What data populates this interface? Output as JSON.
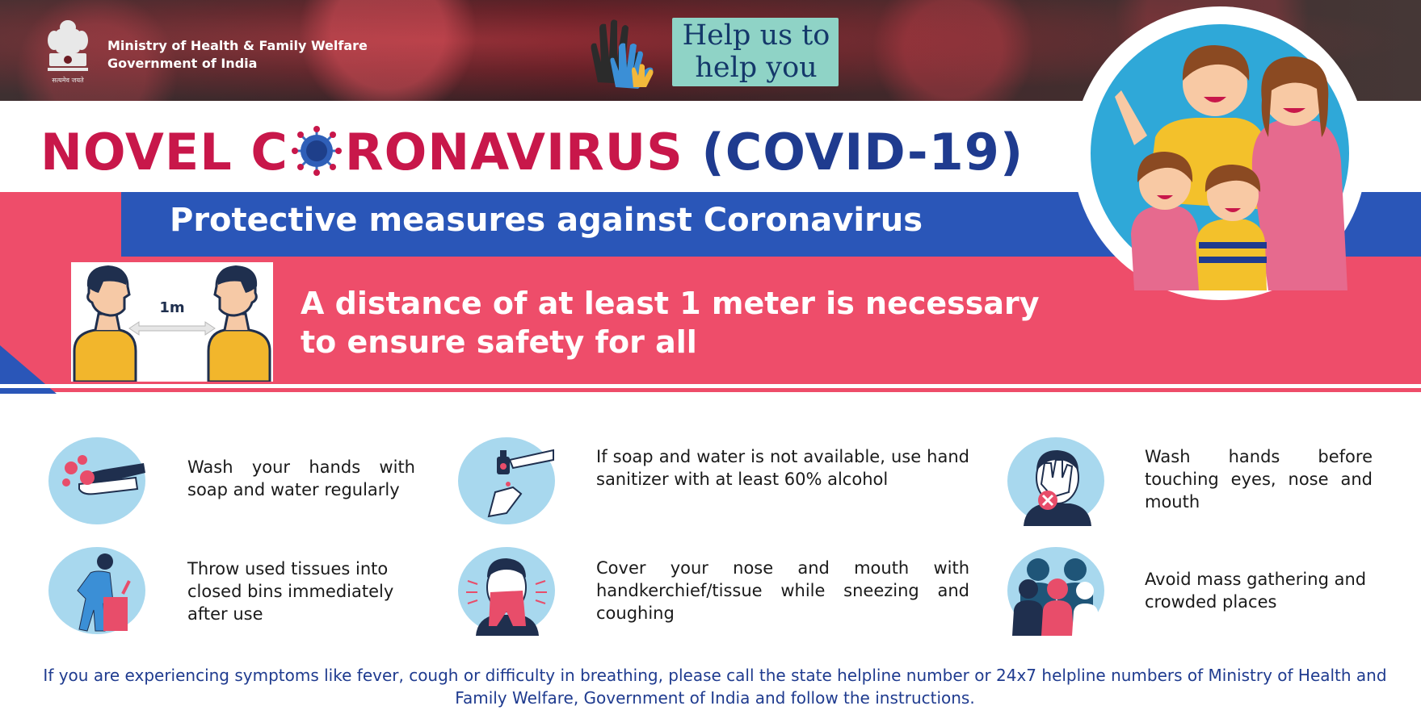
{
  "header": {
    "ministry_line1": "Ministry of Health & Family Welfare",
    "ministry_line2": "Government of India",
    "emblem_motto": "सत्यमेव जयते",
    "help_line1": "Help us to",
    "help_line2": "help you"
  },
  "title": {
    "part1": "NOVEL C",
    "part2": "RONAVIRUS",
    "part3": "(COVID-19)"
  },
  "subtitle": "Protective measures against Coronavirus",
  "distance": {
    "line1": "A distance of at least 1 meter is necessary",
    "line2": "to ensure safety for all",
    "label": "1m"
  },
  "measures": [
    {
      "icon": "hand-washing-icon",
      "text": "Wash your hands with soap and water regularly"
    },
    {
      "icon": "hand-sanitizer-icon",
      "text": "If soap and water is not available, use hand sanitizer with at least 60% alcohol"
    },
    {
      "icon": "no-face-touch-icon",
      "text": "Wash hands before touching eyes, nose and mouth"
    },
    {
      "icon": "tissue-bin-icon",
      "text": "Throw used tissues into closed bins immediately after use"
    },
    {
      "icon": "sneeze-cover-icon",
      "text": "Cover your nose and mouth with handkerchief/tissue while sneezing and coughing"
    },
    {
      "icon": "crowd-icon",
      "text": "Avoid mass gathering and crowded places"
    }
  ],
  "footer": "If you are experiencing symptoms like fever, cough or difficulty in breathing, please call the state helpline number or 24x7 helpline numbers of Ministry of Health and Family Welfare, Government of India and follow the instructions.",
  "colors": {
    "red": "#c8174a",
    "blue": "#1f3b8f",
    "band_blue": "#2a56b8",
    "band_pink": "#ee4d6a",
    "icon_bg": "#a8d8ee"
  }
}
